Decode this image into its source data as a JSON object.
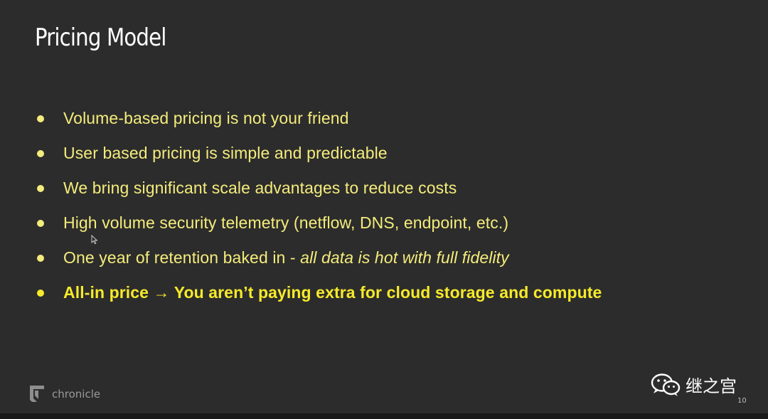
{
  "slide": {
    "title": "Pricing Model",
    "bullets": [
      {
        "text": "Volume-based pricing is not your friend"
      },
      {
        "text": "User based pricing is simple and predictable"
      },
      {
        "text": "We bring significant scale advantages to reduce costs"
      },
      {
        "text": "High volume security telemetry (netflow, DNS, endpoint, etc.)"
      },
      {
        "text": "One year of retention baked in - ",
        "italic": "all data is hot with full fidelity"
      },
      {
        "text": "All-in price → You aren’t paying extra for cloud storage and compute"
      }
    ],
    "logo_text": "chronicle",
    "page_number": "10"
  },
  "watermark": {
    "text": "继之宫",
    "icon": "wechat-icon"
  },
  "colors": {
    "background": "#2c2c2c",
    "bullet_text": "#f4ec7c",
    "bold_text": "#f6ea2a",
    "title": "#ffffff"
  }
}
